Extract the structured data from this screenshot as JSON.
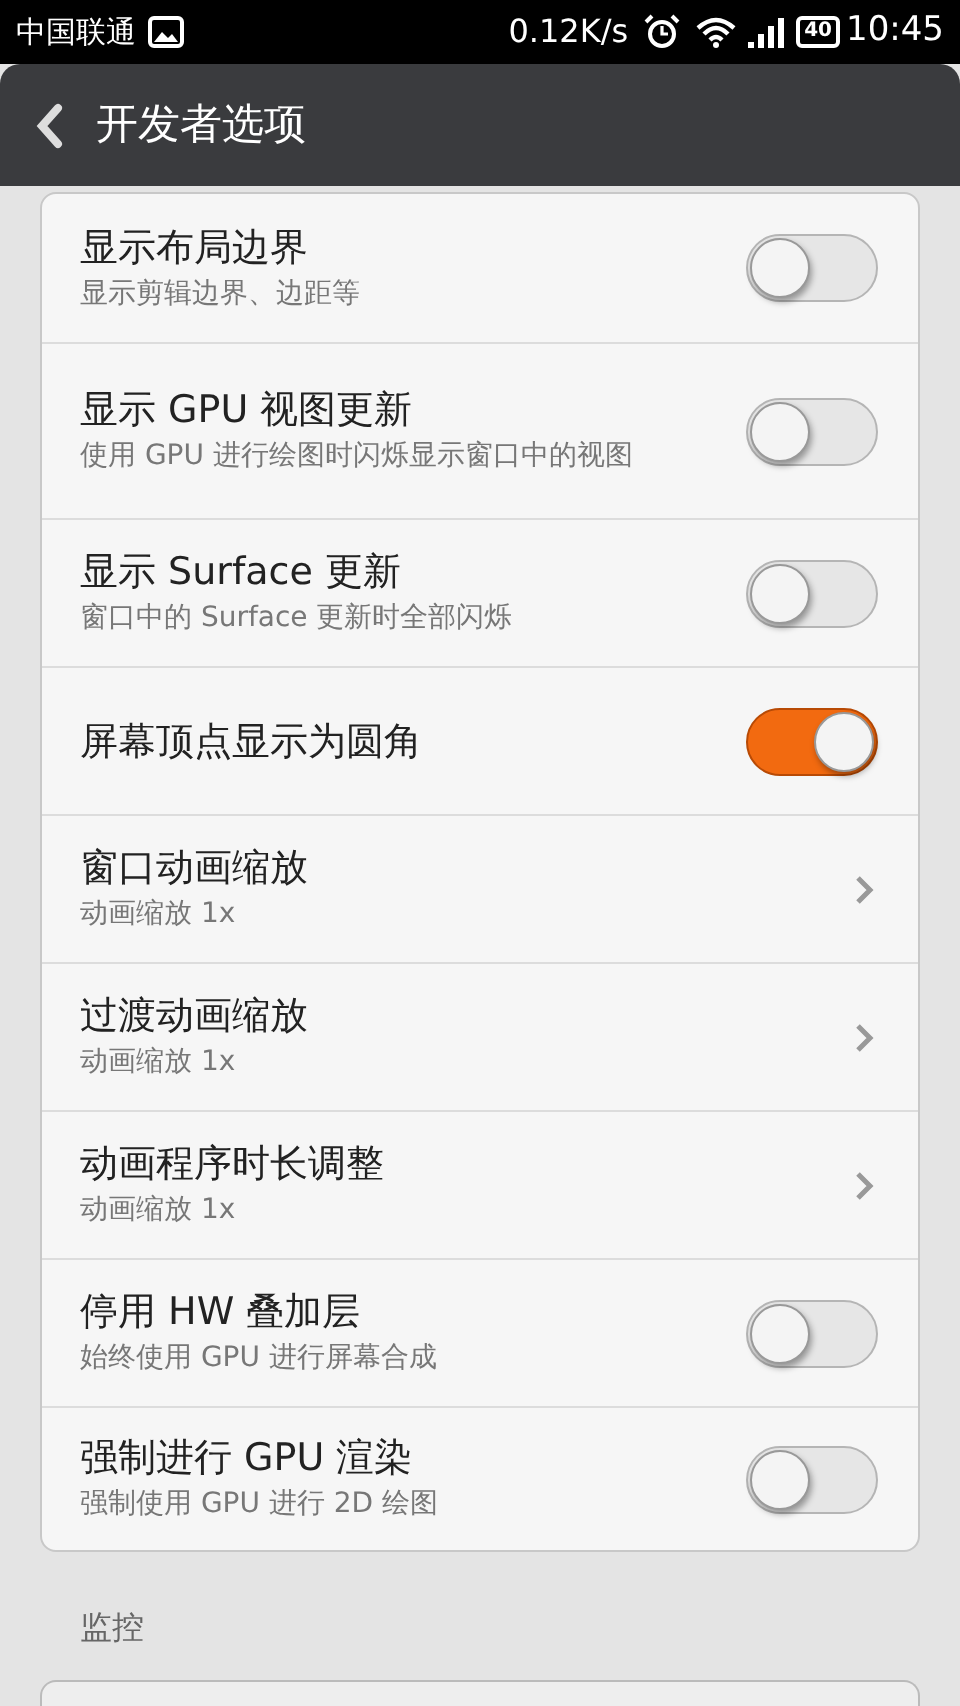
{
  "status_bar": {
    "carrier": "中国联通",
    "speed": "0.12K/s",
    "battery": "40",
    "time": "10:45"
  },
  "header": {
    "title": "开发者选项"
  },
  "rows": [
    {
      "kind": "toggle",
      "title": "显示布局边界",
      "subtitle": "显示剪辑边界、边距等",
      "on": false
    },
    {
      "kind": "toggle",
      "title": "显示 GPU 视图更新",
      "subtitle": "使用 GPU 进行绘图时闪烁显示窗口中的视图",
      "on": false
    },
    {
      "kind": "toggle",
      "title": "显示 Surface 更新",
      "subtitle": "窗口中的 Surface 更新时全部闪烁",
      "on": false
    },
    {
      "kind": "toggle",
      "title": "屏幕顶点显示为圆角",
      "on": true
    },
    {
      "kind": "arrow",
      "title": "窗口动画缩放",
      "subtitle": "动画缩放 1x"
    },
    {
      "kind": "arrow",
      "title": "过渡动画缩放",
      "subtitle": "动画缩放 1x"
    },
    {
      "kind": "arrow",
      "title": "动画程序时长调整",
      "subtitle": "动画缩放 1x"
    },
    {
      "kind": "toggle",
      "title": "停用 HW 叠加层",
      "subtitle": "始终使用 GPU 进行屏幕合成",
      "on": false
    },
    {
      "kind": "toggle",
      "title": "强制进行 GPU 渲染",
      "subtitle": "强制使用 GPU 进行 2D 绘图",
      "on": false
    }
  ],
  "section": {
    "title": "监控"
  }
}
